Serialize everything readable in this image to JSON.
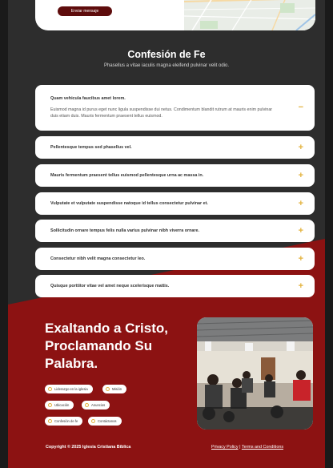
{
  "contact": {
    "send_label": "Enviar mensaje"
  },
  "faith": {
    "title": "Confesión de Fe",
    "subtitle": "Phasellus a vitae iaculis magna eleifend pulvinar velit odio."
  },
  "faq": [
    {
      "question": "Quam vehicula faucibus amet lorem.",
      "answer": "Euismod magna id purus eget nunc ligula suspendisse dui netus. Condimentum blandit rutrum at mauris enim pulvinar duis etiam duis. Mauris fermentum praesent tellus euismod.",
      "icon": "minus-icon",
      "open": true
    },
    {
      "question": "Pellentesque tempus sed phasellus vel.",
      "icon": "plus-icon"
    },
    {
      "question": "Mauris fermentum praesent tellus euismod pellentesque urna ac massa in.",
      "icon": "plus-icon"
    },
    {
      "question": "Vulputate et vulputate suspendisse natoque id tellus consectetur pulvinar et.",
      "icon": "plus-icon"
    },
    {
      "question": "Sollicitudin ornare tempus felis nulla varius pulvinar nibh viverra ornare.",
      "icon": "plus-icon"
    },
    {
      "question": "Consectetur nibh velit magna consectetur leo.",
      "icon": "plus-icon"
    },
    {
      "question": "Quisque porttitor vitae vel amet neque scelerisque mattis.",
      "icon": "plus-icon"
    }
  ],
  "hero": {
    "title": "Exaltando a Cristo, Proclamando Su Palabra.",
    "pills": [
      "Liderazgo en la iglesia",
      "Misión",
      "Ubicación",
      "Anuncios",
      "Confesión de fe",
      "Contáctanos"
    ]
  },
  "footer": {
    "copyright": "Copyright © 2025 Iglesia Cristiana Bíblica",
    "privacy": "Privacy Policy",
    "separator": "|",
    "terms": "Terms and Conditions"
  },
  "colors": {
    "accent_red": "#8c1212",
    "button_dark_red": "#5e0c0c",
    "icon_gold": "#e3b23c",
    "dark_bg": "#2d2d2d"
  }
}
